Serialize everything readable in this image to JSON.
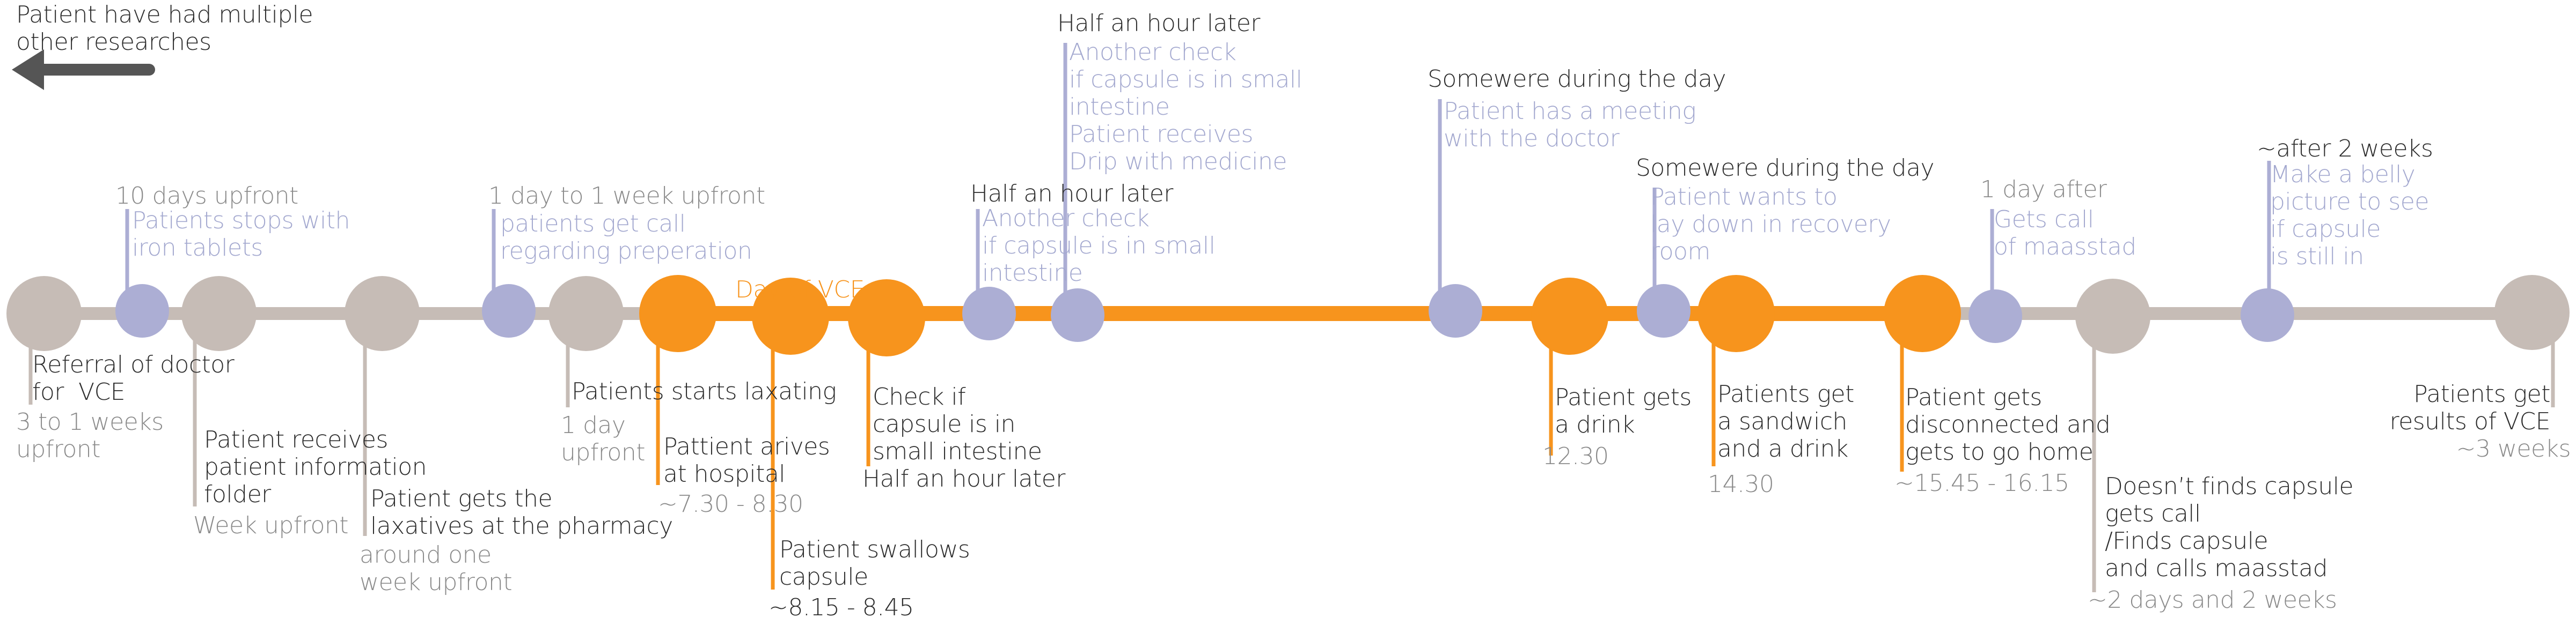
{
  "colors": {
    "orange": "#f7941d",
    "grey_node": "#c6bcb6",
    "purple_node": "#acaed4",
    "text_dark": "#2b2b2b",
    "text_grey": "#8a8a8a",
    "text_purple": "#a3a8cf"
  },
  "header": {
    "lines": [
      "Patient have had multiple",
      "other researches"
    ],
    "arrow_icon": "arrow-left-icon"
  },
  "day_label": "Day of VCE",
  "events": [
    {
      "id": "referral",
      "lines": [
        "Referral of doctor",
        "for  VCE"
      ],
      "time": [
        "3 to 1 weeks",
        "upfront"
      ]
    },
    {
      "id": "stop-iron",
      "when": "10 days upfront",
      "lines": [
        "Patients stops with",
        "iron tablets"
      ]
    },
    {
      "id": "info-folder",
      "lines": [
        "Patient receives",
        "patient information",
        "folder"
      ],
      "time": [
        "Week upfront"
      ]
    },
    {
      "id": "laxatives-pharmacy",
      "lines": [
        "Patient gets the",
        "laxatives at the pharmacy"
      ],
      "time": [
        "around one",
        "week upfront"
      ]
    },
    {
      "id": "prep-call",
      "when": "1 day to 1 week upfront",
      "lines": [
        "patients get call",
        "regarding preperation"
      ]
    },
    {
      "id": "starts-laxating",
      "lines": [
        "Patients starts laxating"
      ],
      "time": [
        "1 day",
        "upfront"
      ]
    },
    {
      "id": "arrives",
      "lines": [
        "Pattient arives",
        "at hospital"
      ],
      "time": [
        "~7.30 - 8.30"
      ]
    },
    {
      "id": "swallows",
      "lines": [
        "Patient swallows",
        "capsule"
      ],
      "time": [
        "~8.15 - 8.45"
      ]
    },
    {
      "id": "check-1",
      "lines": [
        "Check if",
        "capsule is in",
        "small intestine",
        "Half an hour later"
      ]
    },
    {
      "id": "check-2",
      "when": "Half an hour later",
      "lines": [
        "Another check",
        "if capsule is in small",
        "intestine"
      ]
    },
    {
      "id": "drip",
      "when": "Half an hour later",
      "lines": [
        "Another check",
        "if capsule is in small",
        "intestine",
        "Patient receives",
        "Drip with medicine"
      ]
    },
    {
      "id": "doctor-meeting",
      "when": "Somewere during the day",
      "lines": [
        "Patient has a meeting",
        "with the doctor"
      ]
    },
    {
      "id": "drink",
      "lines": [
        "Patient gets",
        "a drink"
      ],
      "time": [
        "12.30"
      ]
    },
    {
      "id": "recovery-room",
      "when": "Somewere during the day",
      "lines": [
        "Patient wants to",
        "lay down in recovery",
        "room"
      ]
    },
    {
      "id": "sandwich",
      "lines": [
        "Patients get",
        "a sandwich",
        "and a drink"
      ],
      "time": [
        "14.30"
      ]
    },
    {
      "id": "disconnected",
      "lines": [
        "Patient gets",
        "disconnected and",
        "gets to go home"
      ],
      "time": [
        "~15.45 - 16.15"
      ]
    },
    {
      "id": "call-maasstad",
      "when": "1 day after",
      "lines": [
        "Gets call",
        "of maasstad"
      ]
    },
    {
      "id": "capsule-found",
      "lines": [
        "Doesn’t finds capsule",
        "gets call",
        "/Finds capsule",
        "and calls maasstad"
      ],
      "time": [
        "~2 days and 2 weeks"
      ]
    },
    {
      "id": "belly-picture",
      "when": "~after 2 weeks",
      "lines": [
        "Make a belly",
        "picture to see",
        "if capsule",
        "is still in"
      ]
    },
    {
      "id": "results",
      "lines": [
        "Patients get",
        "results of VCE"
      ],
      "time": [
        "~3 weeks"
      ]
    }
  ]
}
